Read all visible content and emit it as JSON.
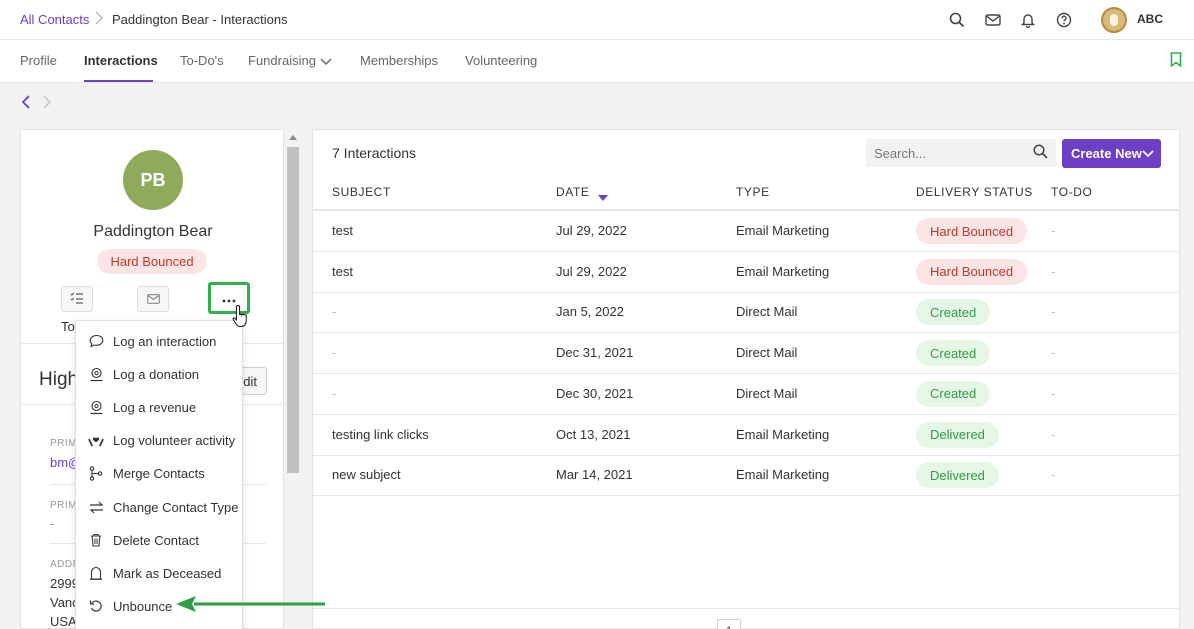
{
  "breadcrumb": {
    "parent": "All Contacts",
    "current": "Paddington Bear - Interactions"
  },
  "header": {
    "org_name": "ABC"
  },
  "tabs": [
    {
      "label": "Profile"
    },
    {
      "label": "Interactions"
    },
    {
      "label": "To-Do's"
    },
    {
      "label": "Fundraising"
    },
    {
      "label": "Memberships"
    },
    {
      "label": "Volunteering"
    }
  ],
  "contact": {
    "initials": "PB",
    "name": "Paddington Bear",
    "status": "Hard Bounced",
    "todo_label_partial": "To",
    "highlights_title_partial": "High",
    "edit_label_partial": "dit",
    "fields": [
      {
        "label": "PRIM",
        "value": "bm@"
      },
      {
        "label": "PRIM",
        "value": "-"
      },
      {
        "label": "ADDR",
        "lines": [
          "2999",
          "Vanc",
          "USA"
        ]
      }
    ]
  },
  "menu": {
    "items": [
      {
        "label": "Log an interaction",
        "icon": "chat-bubble-icon"
      },
      {
        "label": "Log a donation",
        "icon": "donation-icon"
      },
      {
        "label": "Log a revenue",
        "icon": "revenue-icon"
      },
      {
        "label": "Log volunteer activity",
        "icon": "volunteer-hands-icon"
      },
      {
        "label": "Merge Contacts",
        "icon": "merge-icon"
      },
      {
        "label": "Change Contact Type",
        "icon": "swap-arrows-icon"
      },
      {
        "label": "Delete Contact",
        "icon": "trash-icon"
      },
      {
        "label": "Mark as Deceased",
        "icon": "headstone-icon"
      },
      {
        "label": "Unbounce",
        "icon": "undo-icon"
      }
    ]
  },
  "interactions": {
    "title": "7 Interactions",
    "search_placeholder": "Search...",
    "create_label": "Create New",
    "columns": [
      "SUBJECT",
      "DATE",
      "TYPE",
      "DELIVERY STATUS",
      "TO-DO"
    ],
    "rows": [
      {
        "subject": "test",
        "date": "Jul 29, 2022",
        "type": "Email Marketing",
        "status": "Hard Bounced",
        "status_kind": "bounced",
        "todo": "-"
      },
      {
        "subject": "test",
        "date": "Jul 29, 2022",
        "type": "Email Marketing",
        "status": "Hard Bounced",
        "status_kind": "bounced",
        "todo": "-"
      },
      {
        "subject": "-",
        "date": "Jan 5, 2022",
        "type": "Direct Mail",
        "status": "Created",
        "status_kind": "ok",
        "todo": "-"
      },
      {
        "subject": "-",
        "date": "Dec 31, 2021",
        "type": "Direct Mail",
        "status": "Created",
        "status_kind": "ok",
        "todo": "-"
      },
      {
        "subject": "-",
        "date": "Dec 30, 2021",
        "type": "Direct Mail",
        "status": "Created",
        "status_kind": "ok",
        "todo": "-"
      },
      {
        "subject": "testing link clicks",
        "date": "Oct 13, 2021",
        "type": "Email Marketing",
        "status": "Delivered",
        "status_kind": "ok",
        "todo": "-"
      },
      {
        "subject": "new subject",
        "date": "Mar 14, 2021",
        "type": "Email Marketing",
        "status": "Delivered",
        "status_kind": "ok",
        "todo": "-"
      }
    ],
    "current_page": "1"
  },
  "colors": {
    "accent": "#6c3fc5",
    "highlight": "#31b04a",
    "bounced": "#c0392b",
    "success": "#2e9e44"
  }
}
